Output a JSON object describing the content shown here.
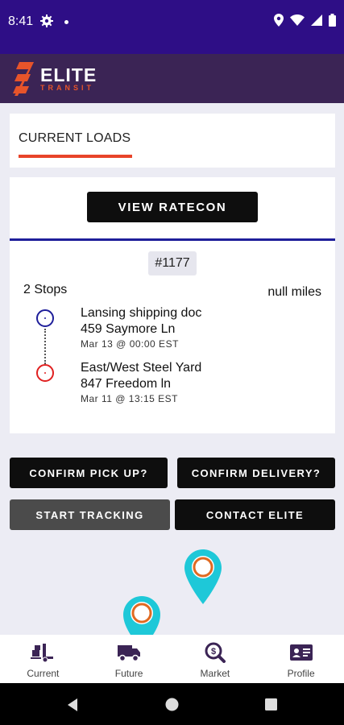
{
  "status_bar": {
    "time": "8:41"
  },
  "header": {
    "logo_big": "ELITE",
    "logo_small": "TRANSIT"
  },
  "tabs": {
    "current_label": "CURRENT LOADS"
  },
  "load": {
    "ratecon_label": "VIEW RATECON",
    "id": "#1177",
    "stops_count": "2 Stops",
    "miles": "null miles",
    "stops": [
      {
        "name": "Lansing shipping doc",
        "address": "459 Saymore Ln",
        "date": "Mar 13 @ 00:00 EST",
        "color": "#1e1e9a"
      },
      {
        "name": "East/West Steel Yard",
        "address": "847 Freedom ln",
        "date": "Mar 11 @ 13:15 EST",
        "color": "#e02020"
      }
    ]
  },
  "actions": {
    "confirm_pickup": "CONFIRM PICK UP?",
    "confirm_delivery": "CONFIRM DELIVERY?",
    "start_tracking": "START TRACKING",
    "contact_elite": "CONTACT ELITE"
  },
  "bottom_nav": [
    {
      "label": "Current",
      "icon": "truck-loading-icon"
    },
    {
      "label": "Future",
      "icon": "truck-icon"
    },
    {
      "label": "Market",
      "icon": "dollar-search-icon"
    },
    {
      "label": "Profile",
      "icon": "id-card-icon"
    }
  ],
  "colors": {
    "status_bar": "#2e0e86",
    "header": "#3b2455",
    "accent": "#e8442a",
    "pin": "#1ec8d8"
  }
}
